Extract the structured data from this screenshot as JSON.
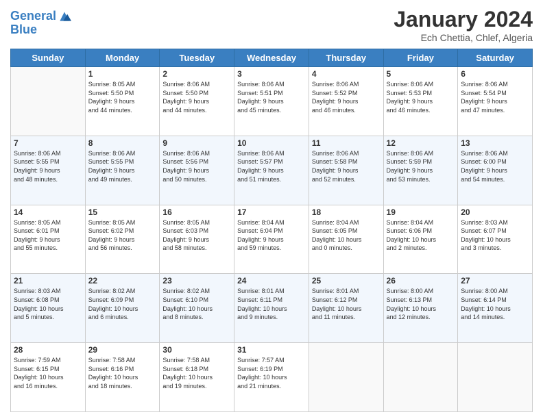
{
  "header": {
    "logo_line1": "General",
    "logo_line2": "Blue",
    "main_title": "January 2024",
    "sub_title": "Ech Chettia, Chlef, Algeria"
  },
  "days_of_week": [
    "Sunday",
    "Monday",
    "Tuesday",
    "Wednesday",
    "Thursday",
    "Friday",
    "Saturday"
  ],
  "weeks": [
    [
      {
        "day": "",
        "info": ""
      },
      {
        "day": "1",
        "info": "Sunrise: 8:05 AM\nSunset: 5:50 PM\nDaylight: 9 hours\nand 44 minutes."
      },
      {
        "day": "2",
        "info": "Sunrise: 8:06 AM\nSunset: 5:50 PM\nDaylight: 9 hours\nand 44 minutes."
      },
      {
        "day": "3",
        "info": "Sunrise: 8:06 AM\nSunset: 5:51 PM\nDaylight: 9 hours\nand 45 minutes."
      },
      {
        "day": "4",
        "info": "Sunrise: 8:06 AM\nSunset: 5:52 PM\nDaylight: 9 hours\nand 46 minutes."
      },
      {
        "day": "5",
        "info": "Sunrise: 8:06 AM\nSunset: 5:53 PM\nDaylight: 9 hours\nand 46 minutes."
      },
      {
        "day": "6",
        "info": "Sunrise: 8:06 AM\nSunset: 5:54 PM\nDaylight: 9 hours\nand 47 minutes."
      }
    ],
    [
      {
        "day": "7",
        "info": "Sunrise: 8:06 AM\nSunset: 5:55 PM\nDaylight: 9 hours\nand 48 minutes."
      },
      {
        "day": "8",
        "info": "Sunrise: 8:06 AM\nSunset: 5:55 PM\nDaylight: 9 hours\nand 49 minutes."
      },
      {
        "day": "9",
        "info": "Sunrise: 8:06 AM\nSunset: 5:56 PM\nDaylight: 9 hours\nand 50 minutes."
      },
      {
        "day": "10",
        "info": "Sunrise: 8:06 AM\nSunset: 5:57 PM\nDaylight: 9 hours\nand 51 minutes."
      },
      {
        "day": "11",
        "info": "Sunrise: 8:06 AM\nSunset: 5:58 PM\nDaylight: 9 hours\nand 52 minutes."
      },
      {
        "day": "12",
        "info": "Sunrise: 8:06 AM\nSunset: 5:59 PM\nDaylight: 9 hours\nand 53 minutes."
      },
      {
        "day": "13",
        "info": "Sunrise: 8:06 AM\nSunset: 6:00 PM\nDaylight: 9 hours\nand 54 minutes."
      }
    ],
    [
      {
        "day": "14",
        "info": "Sunrise: 8:05 AM\nSunset: 6:01 PM\nDaylight: 9 hours\nand 55 minutes."
      },
      {
        "day": "15",
        "info": "Sunrise: 8:05 AM\nSunset: 6:02 PM\nDaylight: 9 hours\nand 56 minutes."
      },
      {
        "day": "16",
        "info": "Sunrise: 8:05 AM\nSunset: 6:03 PM\nDaylight: 9 hours\nand 58 minutes."
      },
      {
        "day": "17",
        "info": "Sunrise: 8:04 AM\nSunset: 6:04 PM\nDaylight: 9 hours\nand 59 minutes."
      },
      {
        "day": "18",
        "info": "Sunrise: 8:04 AM\nSunset: 6:05 PM\nDaylight: 10 hours\nand 0 minutes."
      },
      {
        "day": "19",
        "info": "Sunrise: 8:04 AM\nSunset: 6:06 PM\nDaylight: 10 hours\nand 2 minutes."
      },
      {
        "day": "20",
        "info": "Sunrise: 8:03 AM\nSunset: 6:07 PM\nDaylight: 10 hours\nand 3 minutes."
      }
    ],
    [
      {
        "day": "21",
        "info": "Sunrise: 8:03 AM\nSunset: 6:08 PM\nDaylight: 10 hours\nand 5 minutes."
      },
      {
        "day": "22",
        "info": "Sunrise: 8:02 AM\nSunset: 6:09 PM\nDaylight: 10 hours\nand 6 minutes."
      },
      {
        "day": "23",
        "info": "Sunrise: 8:02 AM\nSunset: 6:10 PM\nDaylight: 10 hours\nand 8 minutes."
      },
      {
        "day": "24",
        "info": "Sunrise: 8:01 AM\nSunset: 6:11 PM\nDaylight: 10 hours\nand 9 minutes."
      },
      {
        "day": "25",
        "info": "Sunrise: 8:01 AM\nSunset: 6:12 PM\nDaylight: 10 hours\nand 11 minutes."
      },
      {
        "day": "26",
        "info": "Sunrise: 8:00 AM\nSunset: 6:13 PM\nDaylight: 10 hours\nand 12 minutes."
      },
      {
        "day": "27",
        "info": "Sunrise: 8:00 AM\nSunset: 6:14 PM\nDaylight: 10 hours\nand 14 minutes."
      }
    ],
    [
      {
        "day": "28",
        "info": "Sunrise: 7:59 AM\nSunset: 6:15 PM\nDaylight: 10 hours\nand 16 minutes."
      },
      {
        "day": "29",
        "info": "Sunrise: 7:58 AM\nSunset: 6:16 PM\nDaylight: 10 hours\nand 18 minutes."
      },
      {
        "day": "30",
        "info": "Sunrise: 7:58 AM\nSunset: 6:18 PM\nDaylight: 10 hours\nand 19 minutes."
      },
      {
        "day": "31",
        "info": "Sunrise: 7:57 AM\nSunset: 6:19 PM\nDaylight: 10 hours\nand 21 minutes."
      },
      {
        "day": "",
        "info": ""
      },
      {
        "day": "",
        "info": ""
      },
      {
        "day": "",
        "info": ""
      }
    ]
  ]
}
